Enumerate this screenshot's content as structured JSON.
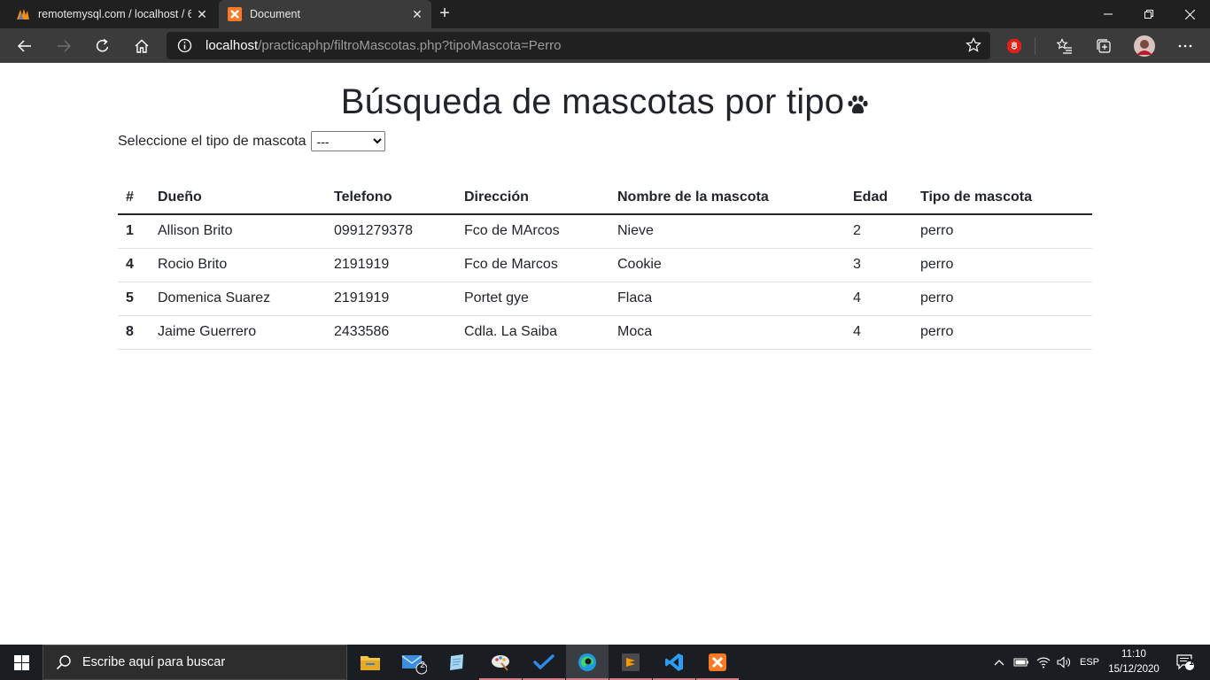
{
  "browser": {
    "tabs": [
      {
        "title": "remotemysql.com / localhost / 6",
        "active": false
      },
      {
        "title": "Document",
        "active": true
      }
    ],
    "address": {
      "host": "localhost",
      "path": "/practicaphp/filtroMascotas.php?tipoMascota=Perro"
    }
  },
  "page": {
    "title": "Búsqueda de mascotas por tipo",
    "filter": {
      "label": "Seleccione el tipo de mascota",
      "selected": "---"
    },
    "table": {
      "columns": [
        "#",
        "Dueño",
        "Telefono",
        "Dirección",
        "Nombre de la mascota",
        "Edad",
        "Tipo de mascota"
      ],
      "rows": [
        [
          "1",
          "Allison Brito",
          "0991279378",
          "Fco de MArcos",
          "Nieve",
          "2",
          "perro"
        ],
        [
          "4",
          "Rocio Brito",
          "2191919",
          "Fco de Marcos",
          "Cookie",
          "3",
          "perro"
        ],
        [
          "5",
          "Domenica Suarez",
          "2191919",
          "Portet gye",
          "Flaca",
          "4",
          "perro"
        ],
        [
          "8",
          "Jaime Guerrero",
          "2433586",
          "Cdla. La Saiba",
          "Moca",
          "4",
          "perro"
        ]
      ]
    }
  },
  "taskbar": {
    "search_placeholder": "Escribe aquí para buscar",
    "mail_badge": "2",
    "language": "ESP",
    "time": "11:10",
    "date": "15/12/2020",
    "notification_count": "1"
  }
}
